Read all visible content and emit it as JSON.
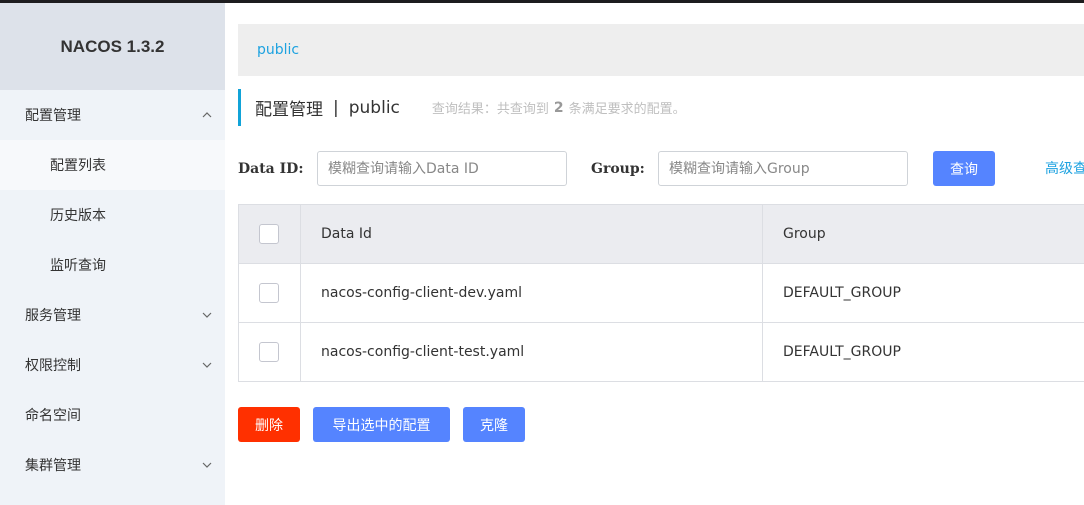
{
  "app": {
    "brand": "NACOS 1.3.2"
  },
  "sidebar": {
    "items": [
      {
        "label": "配置管理",
        "expanded": true,
        "icon": "chevron-up-icon"
      },
      {
        "label": "配置列表",
        "sub": true,
        "active": true
      },
      {
        "label": "历史版本",
        "sub": true
      },
      {
        "label": "监听查询",
        "sub": true
      },
      {
        "label": "服务管理",
        "icon": "chevron-down-icon"
      },
      {
        "label": "权限控制",
        "icon": "chevron-down-icon"
      },
      {
        "label": "命名空间"
      },
      {
        "label": "集群管理",
        "icon": "chevron-down-icon"
      }
    ]
  },
  "namespace_bar": {
    "current": "public"
  },
  "title": {
    "main": "配置管理",
    "separator": "|",
    "namespace": "public",
    "result_prefix": "查询结果：共查询到",
    "result_count": "2",
    "result_suffix": "条满足要求的配置。"
  },
  "search": {
    "data_id_label": "Data ID:",
    "data_id_placeholder": "模糊查询请输入Data ID",
    "data_id_value": "",
    "group_label": "Group:",
    "group_placeholder": "模糊查询请输入Group",
    "group_value": "",
    "query_button": "查询",
    "advanced_link": "高级查"
  },
  "table": {
    "headers": {
      "data_id": "Data Id",
      "group": "Group"
    },
    "rows": [
      {
        "data_id": "nacos-config-client-dev.yaml",
        "group": "DEFAULT_GROUP",
        "checked": false
      },
      {
        "data_id": "nacos-config-client-test.yaml",
        "group": "DEFAULT_GROUP",
        "checked": false
      }
    ]
  },
  "actions": {
    "delete": "删除",
    "export_selected": "导出选中的配置",
    "clone": "克隆"
  },
  "colors": {
    "accent_blue": "#5584ff",
    "link_blue": "#1da2e0",
    "danger_red": "#ff3000",
    "sidebar_bg": "#eff3f8"
  }
}
